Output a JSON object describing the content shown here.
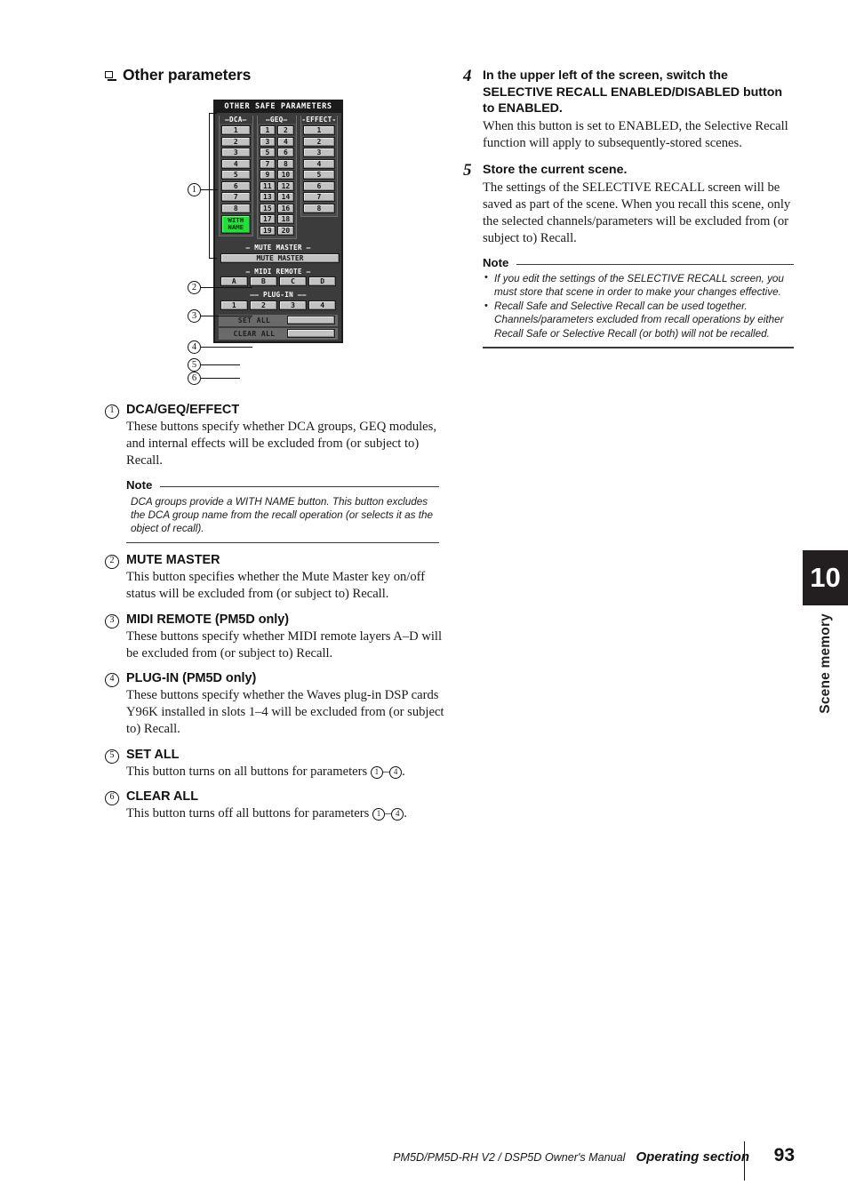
{
  "heading": {
    "bullet": "square-bullet",
    "text": "Other parameters"
  },
  "lcd": {
    "title": "OTHER SAFE PARAMETERS",
    "groups": {
      "dca": {
        "label": "—DCA—",
        "buttons": [
          "1",
          "2",
          "3",
          "4",
          "5",
          "6",
          "7",
          "8"
        ],
        "with_name": [
          "WITH",
          "NAME"
        ]
      },
      "geq": {
        "label": "—GEQ—",
        "buttons": [
          "1",
          "2",
          "3",
          "4",
          "5",
          "6",
          "7",
          "8",
          "9",
          "10",
          "11",
          "12",
          "13",
          "14",
          "15",
          "16",
          "17",
          "18",
          "19",
          "20"
        ]
      },
      "effect": {
        "label": "-EFFECT-",
        "buttons": [
          "1",
          "2",
          "3",
          "4",
          "5",
          "6",
          "7",
          "8"
        ]
      }
    },
    "mute_master": {
      "section_label": "— MUTE MASTER —",
      "button": "MUTE MASTER"
    },
    "midi_remote": {
      "section_label": "— MIDI REMOTE —",
      "buttons": [
        "A",
        "B",
        "C",
        "D"
      ]
    },
    "plug_in": {
      "section_label": "—— PLUG-IN ——",
      "buttons": [
        "1",
        "2",
        "3",
        "4"
      ]
    },
    "set_all": "SET ALL",
    "clear_all": "CLEAR ALL",
    "callouts": [
      "1",
      "2",
      "3",
      "4",
      "5",
      "6"
    ],
    "colors": {
      "background": "#3c3c3c",
      "title_bar": "#1b1b1b",
      "button": "#c2c2c2",
      "button_active": "#22e03a",
      "all_row": "#6a6a6a"
    }
  },
  "left_column": {
    "items": [
      {
        "num": "1",
        "title": "DCA/GEQ/EFFECT",
        "body": "These buttons specify whether DCA groups, GEQ modules, and internal effects will be excluded from (or subject to) Recall."
      },
      {
        "num": "2",
        "title": "MUTE MASTER",
        "body": "This button specifies whether the Mute Master key on/off status will be excluded from (or subject to) Recall."
      },
      {
        "num": "3",
        "title": "MIDI REMOTE (PM5D only)",
        "body": "These buttons specify whether MIDI remote layers A–D will be excluded from (or subject to) Recall."
      },
      {
        "num": "4",
        "title": "PLUG-IN (PM5D only)",
        "body": "These buttons specify whether the Waves plug-in DSP cards Y96K installed in slots 1–4 will be excluded from (or subject to) Recall."
      },
      {
        "num": "5",
        "title": "SET ALL",
        "body_before": "This button turns on all buttons for parameters ",
        "body_c1": "1",
        "body_dash": "–",
        "body_c2": "4",
        "body_after": "."
      },
      {
        "num": "6",
        "title": "CLEAR ALL",
        "body_before": "This button turns off all buttons for parameters ",
        "body_c1": "1",
        "body_dash": "–",
        "body_c2": "4",
        "body_after": "."
      }
    ],
    "note": {
      "head": "Note",
      "text": "DCA groups provide a WITH NAME button. This button excludes the DCA group name from the recall operation (or selects it as the object of recall)."
    }
  },
  "right_column": {
    "steps": [
      {
        "num": "4",
        "title": "In the upper left of the screen, switch the SELECTIVE RECALL ENABLED/DISABLED button to ENABLED.",
        "text": "When this button is set to ENABLED, the Selective Recall function will apply to subsequently-stored scenes."
      },
      {
        "num": "5",
        "title": "Store the current scene.",
        "text": "The settings of the SELECTIVE RECALL screen will be saved as part of the scene. When you recall this scene, only the selected channels/parameters will be excluded from (or subject to) Recall."
      }
    ],
    "note": {
      "head": "Note",
      "bullets": [
        "If you edit the settings of the SELECTIVE RECALL screen, you must store that scene in order to make your changes effective.",
        "Recall Safe and Selective Recall can be used together. Channels/parameters excluded from recall operations by either Recall Safe or Selective Recall (or both) will not be recalled."
      ]
    }
  },
  "chapter_tab": {
    "number": "10",
    "label": "Scene memory"
  },
  "footer": {
    "manual": "PM5D/PM5D-RH V2 / DSP5D Owner's Manual",
    "section": "Operating section",
    "page": "93"
  }
}
